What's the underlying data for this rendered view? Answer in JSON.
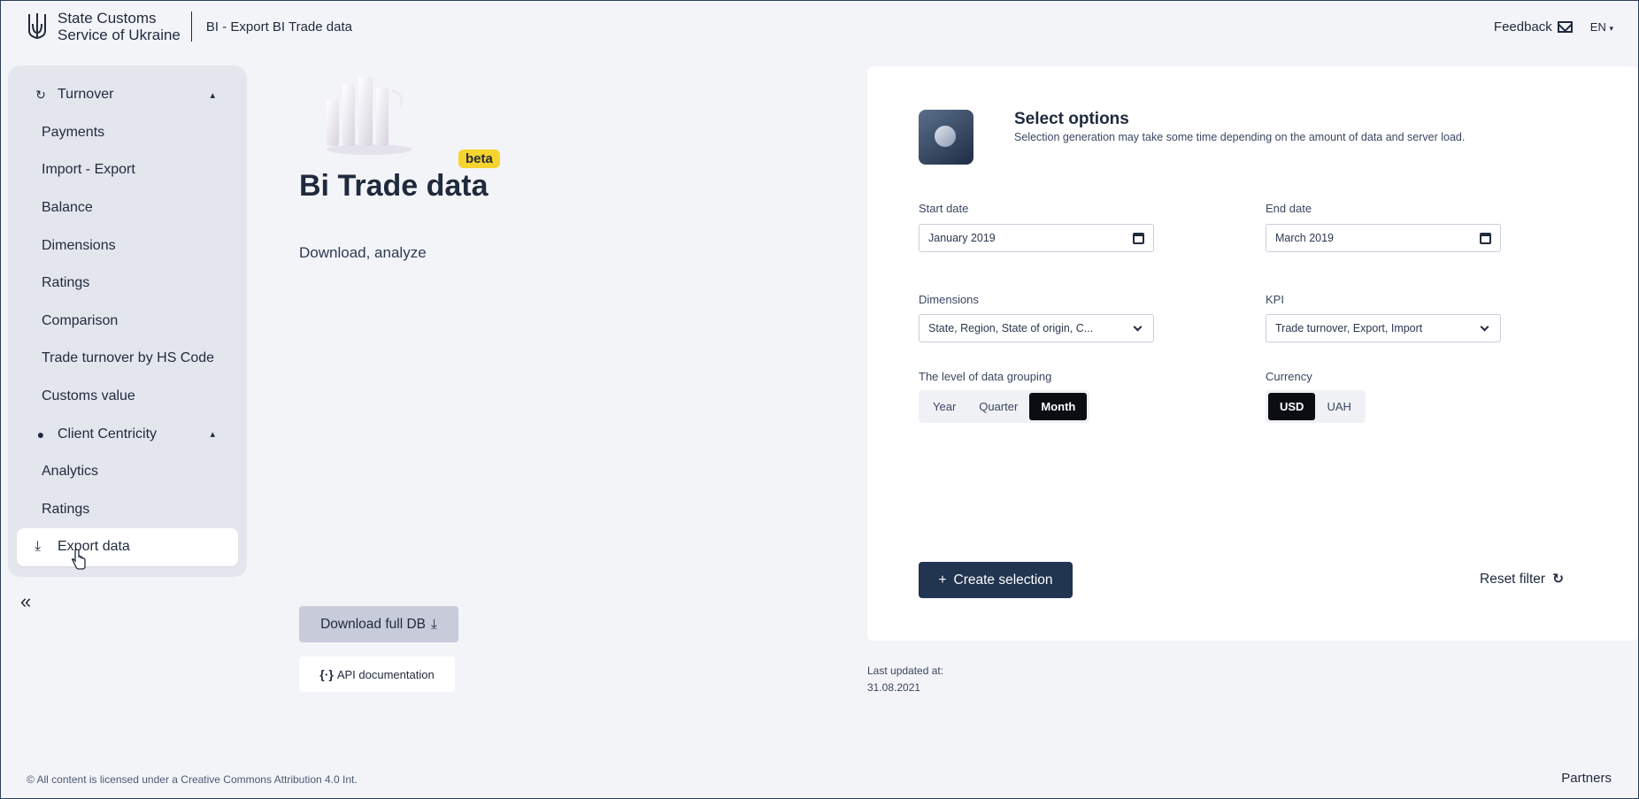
{
  "header": {
    "org_name_line1": "State Customs",
    "org_name_line2": "Service of Ukraine",
    "breadcrumb": "BI - Export BI Trade data",
    "feedback_label": "Feedback",
    "language": "EN"
  },
  "sidebar": {
    "items": [
      {
        "label": "Turnover",
        "type": "section",
        "icon": "refresh-icon"
      },
      {
        "label": "Payments"
      },
      {
        "label": "Import - Export"
      },
      {
        "label": "Balance"
      },
      {
        "label": "Dimensions"
      },
      {
        "label": "Ratings"
      },
      {
        "label": "Comparison"
      },
      {
        "label": "Trade turnover by HS Code"
      },
      {
        "label": "Customs value"
      },
      {
        "label": "Client Centricity",
        "type": "section",
        "icon": "user-icon"
      },
      {
        "label": "Analytics"
      },
      {
        "label": "Ratings"
      },
      {
        "label": "Export data",
        "active": true,
        "icon": "download-tray-icon"
      }
    ],
    "collapse_label": "«"
  },
  "hero": {
    "badge": "beta",
    "title": "Bi Trade data",
    "subtitle": "Download, analyze",
    "download_label": "Download full DB",
    "api_label": "API documentation"
  },
  "options": {
    "title": "Select options",
    "description": "Selection generation may take some time depending on the amount of data and server load.",
    "start_date_label": "Start date",
    "start_date_value": "January 2019",
    "end_date_label": "End date",
    "end_date_value": "March 2019",
    "dimensions_label": "Dimensions",
    "dimensions_value": "State, Region, State of origin, C...",
    "kpi_label": "KPI",
    "kpi_value": "Trade turnover, Export, Import",
    "grouping_label": "The level of data grouping",
    "grouping_options": [
      "Year",
      "Quarter",
      "Month"
    ],
    "grouping_selected": "Month",
    "currency_label": "Currency",
    "currency_options": [
      "USD",
      "UAH"
    ],
    "currency_selected": "USD",
    "create_label": "Create selection",
    "reset_label": "Reset filter"
  },
  "updated": {
    "label": "Last updated at:",
    "date": "31.08.2021"
  },
  "footer": {
    "license": "© All content is licensed under a Creative Commons Attribution 4.0 Int.",
    "partners": "Partners"
  },
  "colors": {
    "primary": "#213450",
    "badge": "#f6d32d",
    "background": "#f3f4f8",
    "sidebar": "#e4e6ee"
  }
}
